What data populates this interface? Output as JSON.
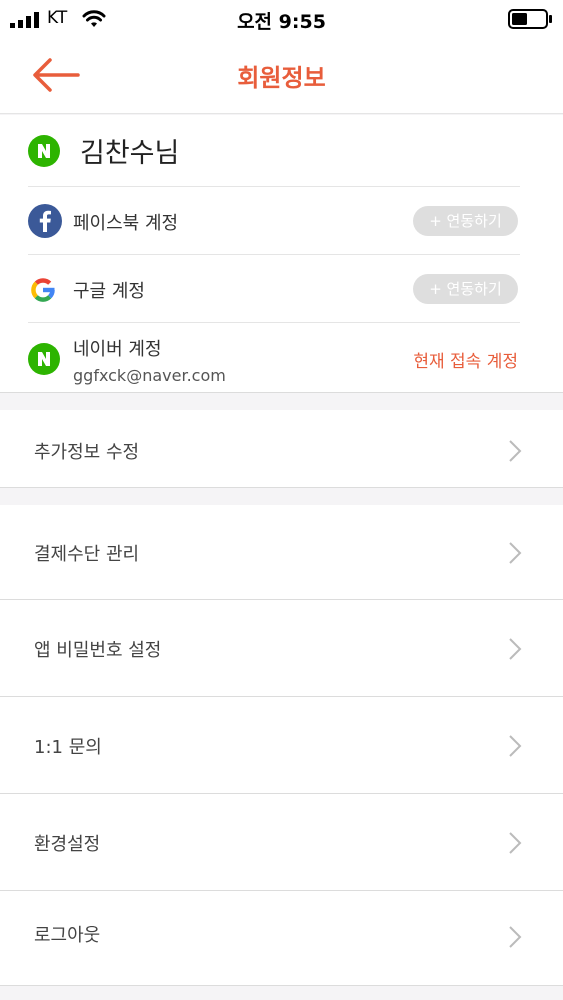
{
  "status": {
    "carrier": "KT",
    "time": "오전 9:55"
  },
  "header": {
    "title": "회원정보"
  },
  "profile": {
    "name": "김찬수님"
  },
  "accounts": {
    "facebook": {
      "label": "페이스북 계정",
      "button": "+ 연동하기"
    },
    "google": {
      "label": "구글 계정",
      "button": "+ 연동하기"
    },
    "naver": {
      "label": "네이버 계정",
      "email": "ggfxck@naver.com",
      "status": "현재 접속 계정"
    }
  },
  "menu": {
    "extra_info": "추가정보 수정",
    "payment": "결제수단 관리",
    "app_password": "앱 비밀번호 설정",
    "inquiry": "1:1 문의",
    "settings": "환경설정",
    "logout": "로그아웃"
  },
  "colors": {
    "accent": "#e85d3b",
    "naver": "#2db400",
    "facebook": "#3b5998"
  },
  "icons": [
    "signal-icon",
    "wifi-icon",
    "battery-icon",
    "back-arrow-icon",
    "naver-icon",
    "facebook-icon",
    "google-icon",
    "chevron-right-icon"
  ]
}
